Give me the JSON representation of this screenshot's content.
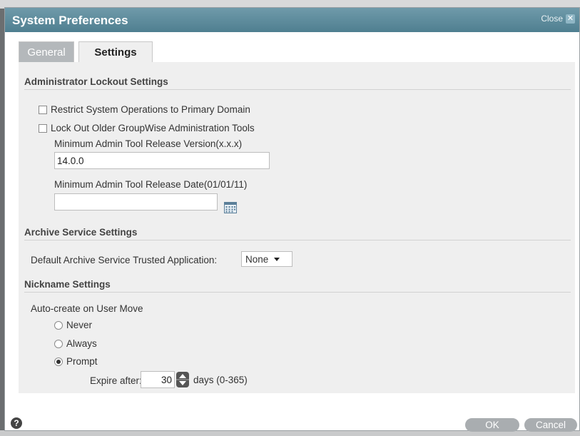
{
  "dialog": {
    "title": "System Preferences",
    "close_label": "Close",
    "close_glyph": "✕"
  },
  "tabs": [
    {
      "label": "General",
      "active": false
    },
    {
      "label": "Settings",
      "active": true
    }
  ],
  "lockout": {
    "header": "Administrator Lockout Settings",
    "restrict_label": "Restrict System Operations to Primary Domain",
    "restrict_checked": false,
    "lockout_label": "Lock Out Older GroupWise Administration Tools",
    "lockout_checked": false,
    "min_version_label": "Minimum Admin Tool Release Version(x.x.x)",
    "min_version_value": "14.0.0",
    "min_date_label": "Minimum Admin Tool Release Date(01/01/11)",
    "min_date_value": ""
  },
  "archive": {
    "header": "Archive Service Settings",
    "trusted_app_label": "Default Archive Service Trusted Application:",
    "trusted_app_value": "None"
  },
  "nickname": {
    "header": "Nickname Settings",
    "auto_create_label": "Auto-create on User Move",
    "options": [
      "Never",
      "Always",
      "Prompt"
    ],
    "selected": "Prompt",
    "expire_label": "Expire after:",
    "expire_value": "30",
    "expire_unit": "days (0-365)"
  },
  "footer": {
    "help_glyph": "?",
    "ok_label": "OK",
    "cancel_label": "Cancel"
  },
  "colors": {
    "titlebar": "#5a8a9b",
    "panel": "#efefef",
    "button": "#a9adb0"
  }
}
